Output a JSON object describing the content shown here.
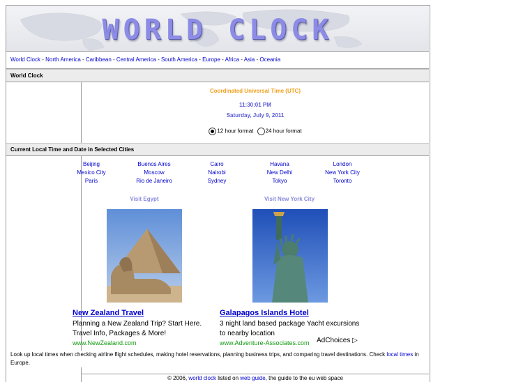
{
  "banner": {
    "logo_text": "WORLD CLOCK"
  },
  "nav": {
    "items": [
      "World Clock",
      "North America",
      "Caribbean",
      "Central America",
      "South America",
      "Europe",
      "Africa",
      "Asia",
      "Oceania"
    ],
    "separator": " - "
  },
  "sections": {
    "world_clock": "World Clock",
    "local_times": "Current Local Time and Date in Selected Cities"
  },
  "utc": {
    "title": "Coordinated Universal Time (UTC)",
    "time": "11:30:01 PM",
    "date": "Saturday, July 9, 2011",
    "format_12": "12 hour format",
    "format_24": "24 hour format",
    "selected": "12"
  },
  "cities": {
    "col1": [
      "Beijing",
      "Mexico City",
      "Paris"
    ],
    "col2": [
      "Buenos Aires",
      "Moscow",
      "Rio de Janeiro"
    ],
    "col3": [
      "Cairo",
      "Nairobi",
      "Sydney"
    ],
    "col4": [
      "Havana",
      "New Delhi",
      "Tokyo"
    ],
    "col5": [
      "London",
      "New York City",
      "Toronto"
    ]
  },
  "promos": {
    "egypt": "Visit Egypt",
    "nyc": "Visit New York City"
  },
  "ads": [
    {
      "title": "New Zealand Travel",
      "line1": "Planning a New Zealand Trip? Start Here.",
      "line2": "Travel Info, Packages & More!",
      "url": "www.NewZealand.com"
    },
    {
      "title": "Galapagos Islands Hotel",
      "line1": "3 night land based package Yacht excursions",
      "line2": "to nearby location",
      "url": "www.Adventure-Associates.com"
    }
  ],
  "adchoices": {
    "label": "AdChoices",
    "icon": "play-triangle-icon"
  },
  "description": {
    "text": "Look up local times when checking airline flight schedules, making hotel reservations, planning business trips, and comparing travel destinations. Check ",
    "link": "local times",
    "tail": " in Europe."
  },
  "footer": {
    "copyright": "© 2006, ",
    "site_link": "world clock",
    "mid": " listed on ",
    "guide_link": "web guide",
    "tail": ", the guide to the eu web space"
  },
  "colors": {
    "link": "#0000cc",
    "utc_title": "#f0a020",
    "utc_time": "#5b5bd6",
    "ad_url": "#129912",
    "section_bg": "#ececec"
  }
}
